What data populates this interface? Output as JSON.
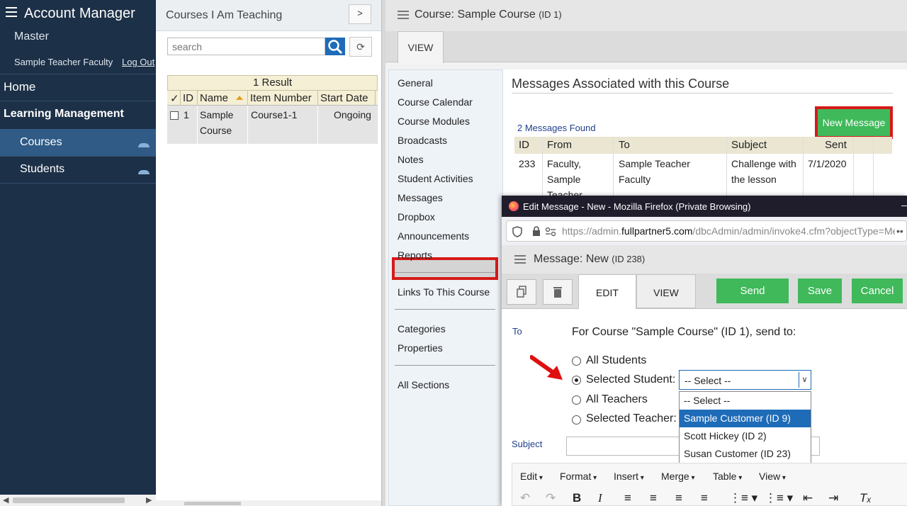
{
  "nav": {
    "app_title": "Account Manager",
    "subtitle": "Master",
    "user_name": "Sample Teacher Faculty",
    "logout": "Log Out",
    "home": "Home",
    "section": "Learning Management",
    "items": [
      {
        "label": "Courses",
        "active": true
      },
      {
        "label": "Students",
        "active": false
      }
    ]
  },
  "courses_pane": {
    "title": "Courses I Am Teaching",
    "expand_label": ">",
    "search_placeholder": "search",
    "result_count": "1 Result",
    "columns": [
      "✓",
      "ID",
      "Name",
      "Item Number",
      "Start Date"
    ],
    "rows": [
      {
        "id": "1",
        "name_line1": "Sample",
        "name_line2": "Course",
        "item_number": "Course1-1",
        "start_date": "Ongoing"
      }
    ]
  },
  "course": {
    "title": "Course: Sample Course",
    "id_label": "(ID 1)",
    "tab": "VIEW",
    "sidenav": {
      "group1": [
        "General",
        "Course Calendar",
        "Course Modules",
        "Broadcasts",
        "Notes",
        "Student Activities",
        "Messages",
        "Dropbox",
        "Announcements",
        "Reports"
      ],
      "group2": [
        "Links To This Course"
      ],
      "group3": [
        "Categories",
        "Properties"
      ],
      "group4": [
        "All Sections"
      ]
    },
    "content_title": "Messages Associated with this Course",
    "found": "2 Messages Found",
    "new_message": "New Message",
    "columns": [
      "ID",
      "From",
      "To",
      "Subject",
      "Sent"
    ],
    "rows": [
      {
        "id": "233",
        "from_l1": "Faculty,",
        "from_l2": "Sample",
        "from_l3": "Teacher",
        "to_l1": "Sample Teacher",
        "to_l2": "Faculty",
        "subject_l1": "Challenge with",
        "subject_l2": "the lesson",
        "sent": "7/1/2020"
      }
    ]
  },
  "popup": {
    "window_title": "Edit Message - New - Mozilla Firefox (Private Browsing)",
    "url_prefix": "https://admin.",
    "url_domain": "fullpartner5.com",
    "url_rest": "/dbcAdmin/admin/invoke4.cfm?objectType=Me",
    "title": "Message: New",
    "id_label": "(ID 238)",
    "tabs": [
      "EDIT",
      "VIEW"
    ],
    "buttons": {
      "send": "Send",
      "save": "Save",
      "cancel": "Cancel"
    },
    "to_label": "To",
    "for_course": "For Course \"Sample Course\" (ID 1), send to:",
    "radio_options": [
      {
        "label": "All Students",
        "checked": false
      },
      {
        "label": "Selected Student:",
        "checked": true
      },
      {
        "label": "All Teachers",
        "checked": false
      },
      {
        "label": "Selected Teacher:",
        "checked": false
      }
    ],
    "select_value": "-- Select --",
    "options": [
      {
        "label": "-- Select --",
        "selected": false
      },
      {
        "label": "Sample Customer (ID 9)",
        "selected": true
      },
      {
        "label": "Scott Hickey (ID 2)",
        "selected": false
      },
      {
        "label": "Susan Customer (ID 23)",
        "selected": false
      }
    ],
    "subject_label": "Subject",
    "editor_menu": [
      "Edit",
      "Format",
      "Insert",
      "Merge",
      "Table",
      "View"
    ]
  },
  "colors": {
    "nav_bg": "#1c3047",
    "active_item": "#2f5b86",
    "button_green": "#3fb95a",
    "highlight_red": "#d61a1a",
    "link_blue": "#1f3f8c"
  }
}
